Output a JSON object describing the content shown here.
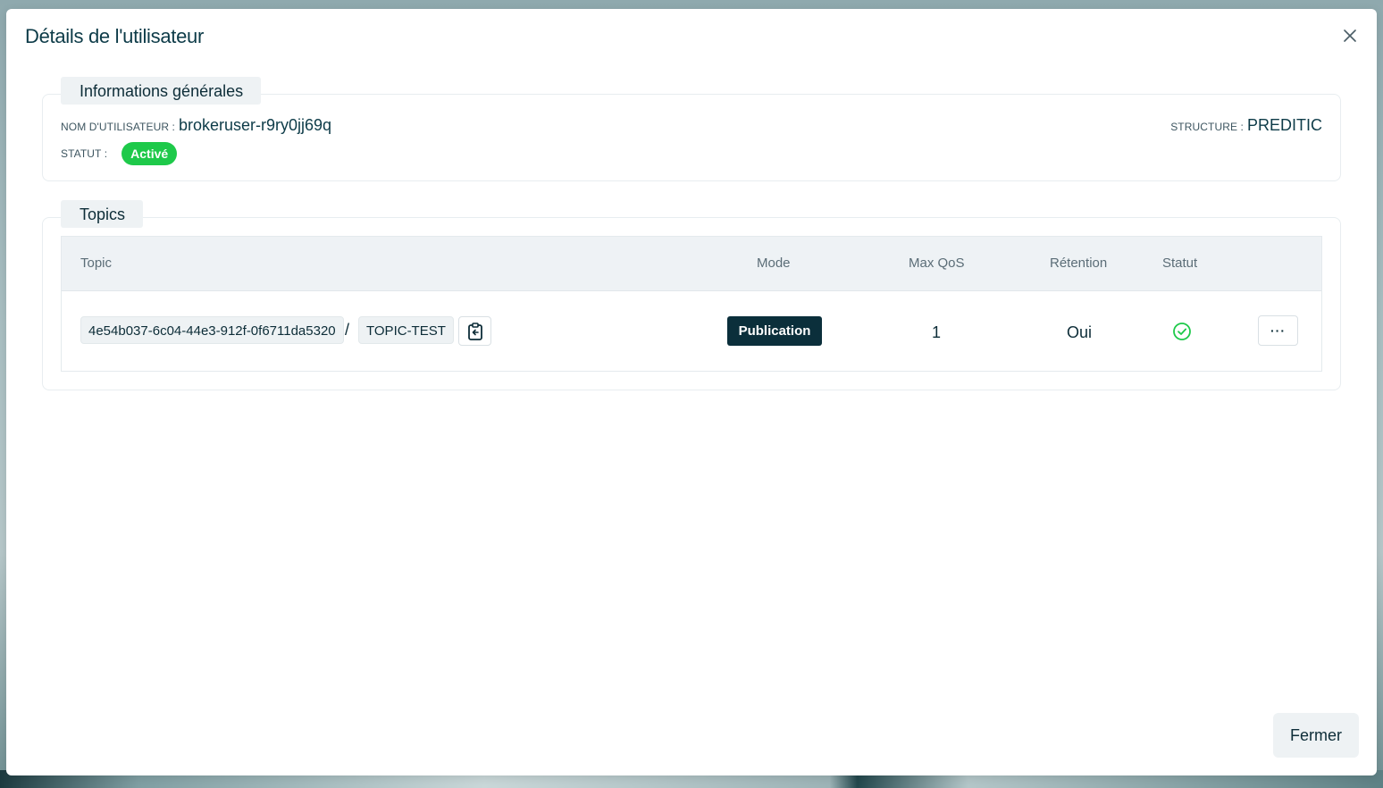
{
  "modal": {
    "title": "Détails de l'utilisateur",
    "close_icon": "close-icon",
    "footer_button": "Fermer"
  },
  "general_info": {
    "section_title": "Informations générales",
    "username_label": "NOM D'UTILISATEUR :",
    "username_value": "brokeruser-r9ry0jj69q",
    "structure_label": "STRUCTURE :",
    "structure_value": "PREDITIC",
    "status_label": "STATUT :",
    "status_value": "Activé",
    "status_color": "#1ec94a"
  },
  "topics": {
    "section_title": "Topics",
    "columns": {
      "topic": "Topic",
      "mode": "Mode",
      "max_qos": "Max QoS",
      "retention": "Rétention",
      "status": "Statut"
    },
    "rows": [
      {
        "topic_prefix": "4e54b037-6c04-44e3-912f-0f6711da5320",
        "separator": "/",
        "topic_name": "TOPIC-TEST",
        "copy_icon": "clipboard-copy-icon",
        "mode": "Publication",
        "max_qos": "1",
        "retention": "Oui",
        "status_icon": "check-circle-icon",
        "status_color": "#1ec94a",
        "actions_label": "···"
      }
    ]
  },
  "colors": {
    "primary_dark": "#0b2f3b",
    "text": "#0d3b48",
    "success": "#1ec94a",
    "muted_bg": "#eef2f4"
  }
}
